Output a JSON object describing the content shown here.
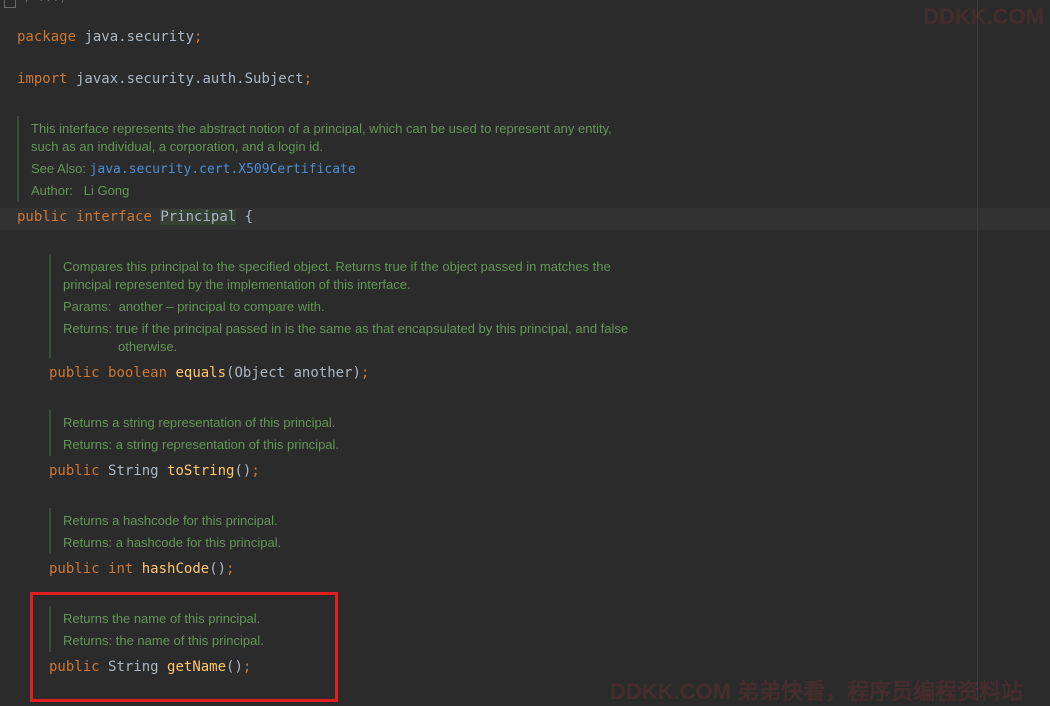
{
  "top_fold": "*, ...)",
  "code": {
    "package_kw": "package",
    "package_name": " java.security",
    "import_kw": "import",
    "import_name": " javax.security.auth.Subject",
    "semicolon": ";",
    "public_kw": "public",
    "interface_kw": "interface",
    "class_name": "Principal",
    "open_brace": " {",
    "equals_ret": "boolean",
    "equals_name": "equals",
    "equals_args": "(Object another)",
    "tostring_ret": "String",
    "tostring_name": "toString",
    "hashcode_ret": "int",
    "hashcode_name": "hashCode",
    "getname_ret": "String",
    "getname_name": "getName",
    "empty_args": "()"
  },
  "docs": {
    "interface": {
      "line1": "This interface represents the abstract notion of a principal, which can be used to represent any entity,",
      "line2": "such as an individual, a corporation, and a login id.",
      "see_also_label": "See Also:",
      "see_also_link": "java.security.cert.X509Certificate",
      "author_label": "Author:",
      "author_value": "Li Gong"
    },
    "equals": {
      "line1": "Compares this principal to the specified object. Returns true if the object passed in matches the",
      "line2": "principal represented by the implementation of this interface.",
      "params_label": "Params:",
      "params_value": "another – principal to compare with.",
      "returns_label": "Returns:",
      "returns_value1": "true if the principal passed in is the same as that encapsulated by this principal, and false",
      "returns_value2": "otherwise."
    },
    "tostring": {
      "line1": "Returns a string representation of this principal.",
      "returns": "Returns: a string representation of this principal."
    },
    "hashcode": {
      "line1": "Returns a hashcode for this principal.",
      "returns": "Returns: a hashcode for this principal."
    },
    "getname": {
      "line1": "Returns the name of this principal.",
      "returns": "Returns: the name of this principal."
    }
  },
  "watermarks": {
    "top": "DDKK.COM",
    "bottom": "DDKK.COM 弟弟快看，程序员编程资料站"
  },
  "colors": {
    "background": "#2b2b2b",
    "keyword": "#cc7832",
    "method": "#ffc66d",
    "doc_text": "#629755",
    "link": "#4a8fd8",
    "highlight_box": "#e02020"
  }
}
